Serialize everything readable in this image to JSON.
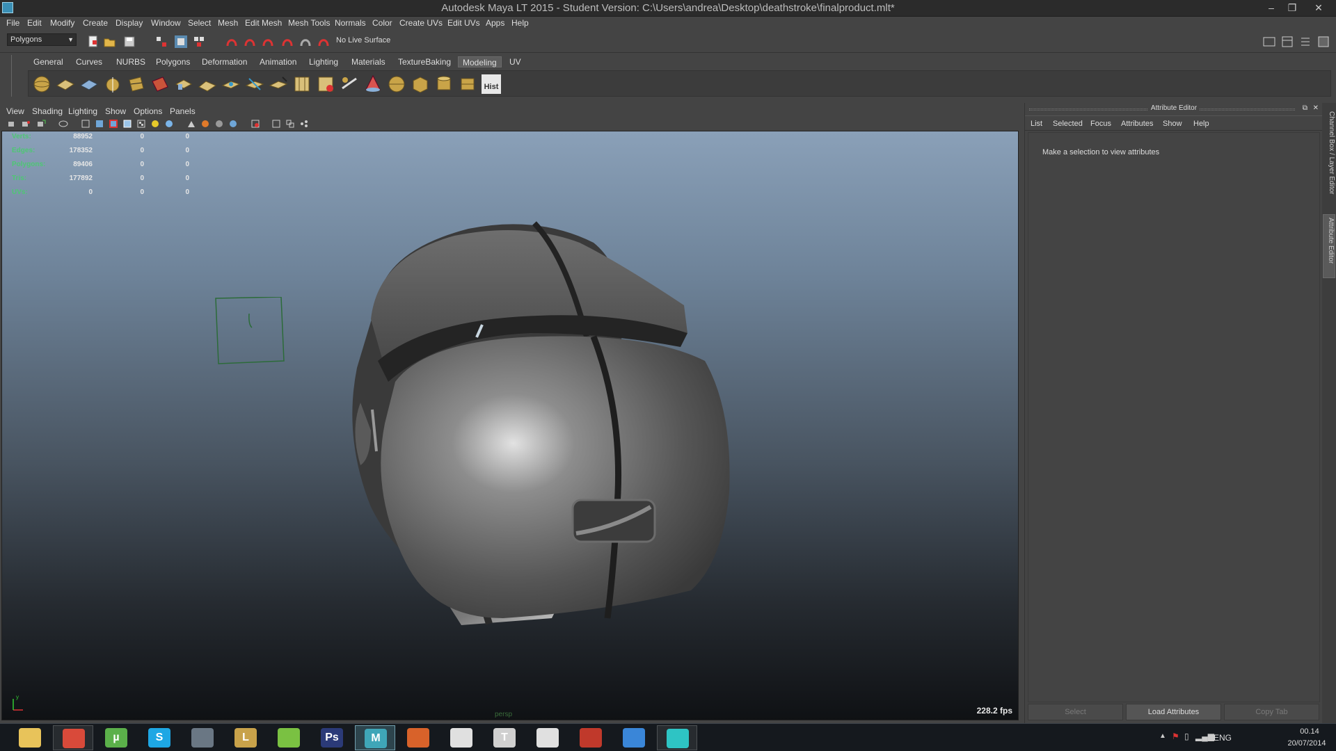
{
  "window": {
    "title": "Autodesk Maya LT 2015 - Student Version: C:\\Users\\andrea\\Desktop\\deathstroke\\finalproduct.mlt*",
    "minimize_glyph": "–",
    "restore_glyph": "❐",
    "close_glyph": "✕"
  },
  "menubar": [
    "File",
    "Edit",
    "Modify",
    "Create",
    "Display",
    "Window",
    "Select",
    "Mesh",
    "Edit Mesh",
    "Mesh Tools",
    "Normals",
    "Color",
    "Create UVs",
    "Edit UVs",
    "Apps",
    "Help"
  ],
  "statusline": {
    "mode": "Polygons",
    "live_surface": "No Live Surface"
  },
  "shelf": {
    "tabs": [
      "General",
      "Curves",
      "NURBS",
      "Polygons",
      "Deformation",
      "Animation",
      "Lighting",
      "Materials",
      "TextureBaking",
      "Modeling",
      "UV"
    ],
    "active_tab": "Modeling",
    "hist_label": "Hist"
  },
  "viewport": {
    "menu": [
      "View",
      "Shading",
      "Lighting",
      "Show",
      "Options",
      "Panels"
    ],
    "hud": [
      {
        "label": "Verts:",
        "v1": "88952",
        "v2": "0",
        "v3": "0"
      },
      {
        "label": "Edges:",
        "v1": "178352",
        "v2": "0",
        "v3": "0"
      },
      {
        "label": "Polygons:",
        "v1": "89406",
        "v2": "0",
        "v3": "0"
      },
      {
        "label": "Tris:",
        "v1": "177892",
        "v2": "0",
        "v3": "0"
      },
      {
        "label": "UVs:",
        "v1": "0",
        "v2": "0",
        "v3": "0"
      }
    ],
    "fps": "228.2 fps",
    "camera": "persp",
    "axis_label": "y"
  },
  "attribute_editor": {
    "title": "Attribute Editor",
    "menu": [
      "List",
      "Selected",
      "Focus",
      "Attributes",
      "Show",
      "Help"
    ],
    "message": "Make a selection to view attributes",
    "buttons": {
      "select": "Select",
      "load": "Load Attributes",
      "copy": "Copy Tab"
    }
  },
  "side_tabs": {
    "channel_box": "Channel Box / Layer Editor",
    "attribute_editor": "Attribute Editor"
  },
  "taskbar": {
    "apps": [
      {
        "name": "file-explorer-icon",
        "glyph": "",
        "color": "#e8c35a",
        "state": "normal"
      },
      {
        "name": "chrome-icon",
        "glyph": "",
        "color": "#d94a3a",
        "state": "running"
      },
      {
        "name": "utorrent-icon",
        "glyph": "µ",
        "color": "#5bb04a",
        "state": "normal"
      },
      {
        "name": "skype-icon",
        "glyph": "S",
        "color": "#1ea7e4",
        "state": "normal"
      },
      {
        "name": "steam-icon",
        "glyph": "",
        "color": "#6a7784",
        "state": "normal"
      },
      {
        "name": "league-of-legends-icon",
        "glyph": "L",
        "color": "#c8a24a",
        "state": "normal"
      },
      {
        "name": "spotify-icon",
        "glyph": "",
        "color": "#7ac142",
        "state": "normal"
      },
      {
        "name": "photoshop-icon",
        "glyph": "Ps",
        "color": "#2b3a78",
        "state": "normal"
      },
      {
        "name": "maya-lt-icon",
        "glyph": "M",
        "color": "#3fa6b8",
        "state": "active"
      },
      {
        "name": "mudbox-icon",
        "glyph": "",
        "color": "#d8622a",
        "state": "normal"
      },
      {
        "name": "unity-icon",
        "glyph": "",
        "color": "#e0e0e0",
        "state": "normal"
      },
      {
        "name": "unreal-icon",
        "glyph": "T",
        "color": "#d0d0d0",
        "state": "normal"
      },
      {
        "name": "zbrush-icon",
        "glyph": "",
        "color": "#e0e0e0",
        "state": "normal"
      },
      {
        "name": "app-alert-icon",
        "glyph": "",
        "color": "#c0392b",
        "state": "normal"
      },
      {
        "name": "browser-icon",
        "glyph": "",
        "color": "#3a86d8",
        "state": "normal"
      },
      {
        "name": "remote-desktop-icon",
        "glyph": "",
        "color": "#2ec4c4",
        "state": "running"
      }
    ],
    "tray": {
      "language": "ENG",
      "time": "00.14",
      "date": "20/07/2014"
    }
  },
  "colors": {
    "hud_label": "#4ec774",
    "accent": "#3fa6b8"
  }
}
